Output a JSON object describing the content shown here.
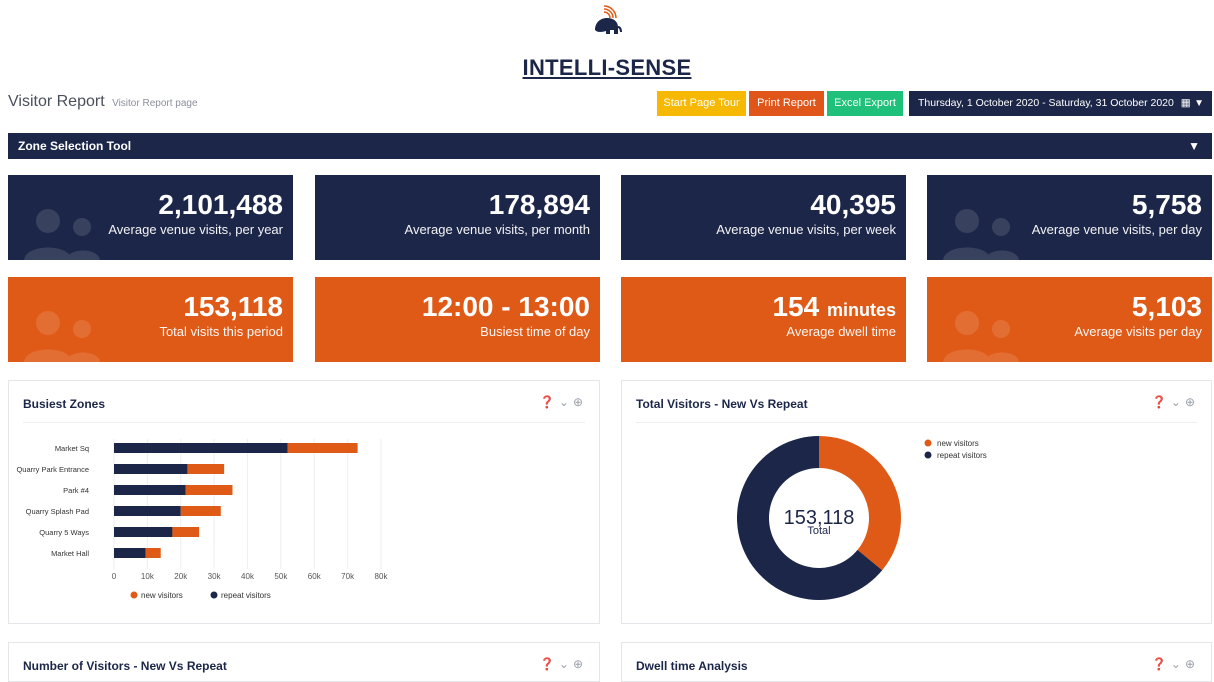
{
  "brand": {
    "name": "INTELLI-SENSE",
    "logo_icon": "elephant-wifi-icon"
  },
  "header": {
    "title": "Visitor Report",
    "subtitle": "Visitor Report page"
  },
  "toolbar": {
    "tour_label": "Start Page Tour",
    "print_label": "Print Report",
    "excel_label": "Excel Export",
    "date_range": "Thursday, 1 October 2020 - Saturday, 31 October 2020"
  },
  "zone_tool": {
    "label": "Zone Selection Tool"
  },
  "colors": {
    "navy": "#1c2648",
    "orange": "#e05a17",
    "yellow": "#f6b800",
    "green": "#1fc07a"
  },
  "stats_top": [
    {
      "value": "2,101,488",
      "label": "Average venue visits, per year"
    },
    {
      "value": "178,894",
      "label": "Average venue visits, per month"
    },
    {
      "value": "40,395",
      "label": "Average venue visits, per week"
    },
    {
      "value": "5,758",
      "label": "Average venue visits, per day"
    }
  ],
  "stats_bottom": [
    {
      "value": "153,118",
      "label": "Total visits this period"
    },
    {
      "value": "12:00 - 13:00",
      "label": "Busiest time of day"
    },
    {
      "value": "154",
      "unit": "minutes",
      "label": "Average dwell time"
    },
    {
      "value": "5,103",
      "label": "Average visits per day"
    }
  ],
  "panels": {
    "busiest_zones": "Busiest Zones",
    "total_visitors": "Total Visitors - New Vs Repeat",
    "number_of_visitors": "Number of Visitors - New Vs Repeat",
    "dwell_time": "Dwell time Analysis"
  },
  "chart_data": [
    {
      "type": "bar",
      "orientation": "horizontal",
      "stacked": true,
      "categories": [
        "Market Sq",
        "Quarry Park Entrance",
        "Park #4",
        "Quarry Splash Pad",
        "Quarry 5 Ways",
        "Market Hall"
      ],
      "series": [
        {
          "name": "repeat visitors",
          "color": "#1c2648",
          "values": [
            52000,
            22000,
            21500,
            20000,
            17500,
            9500
          ]
        },
        {
          "name": "new visitors",
          "color": "#e05a17",
          "values": [
            21000,
            11000,
            14000,
            12000,
            8000,
            4500
          ]
        }
      ],
      "xlim": [
        0,
        80000
      ],
      "xticks": [
        "0",
        "10k",
        "20k",
        "30k",
        "40k",
        "50k",
        "60k",
        "70k",
        "80k"
      ],
      "grid": true,
      "legend": "bottom"
    },
    {
      "type": "pie",
      "donut": true,
      "center_value": "153,118",
      "center_label": "Total",
      "series": [
        {
          "name": "new visitors",
          "color": "#e05a17",
          "share": 0.36
        },
        {
          "name": "repeat visitors",
          "color": "#1c2648",
          "share": 0.64
        }
      ],
      "legend": "top-right"
    }
  ]
}
